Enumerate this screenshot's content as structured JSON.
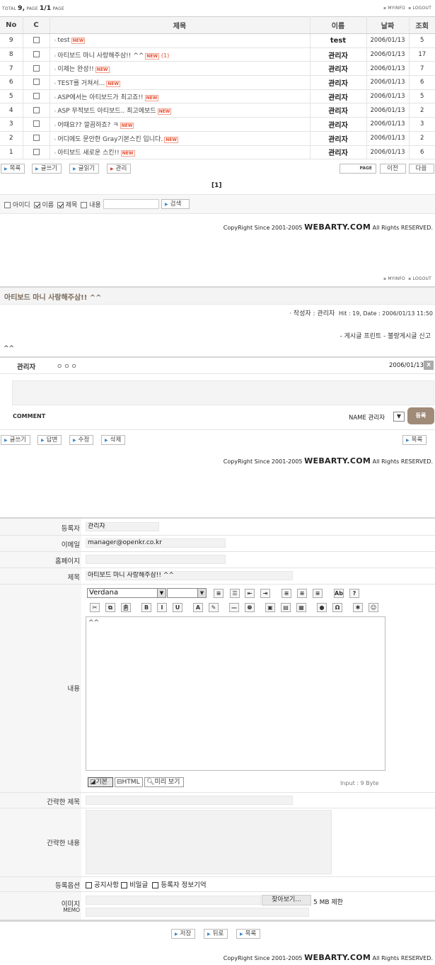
{
  "top": {
    "total_label": "TOTAL",
    "total_value": "9,",
    "page_label": "PAGE",
    "page_value": "1/1",
    "page_suffix": "PAGE",
    "myinfo": "MYINFO",
    "logout": "LOGOUT"
  },
  "table": {
    "headers": [
      "No",
      "C",
      "제목",
      "이름",
      "날짜",
      "조회"
    ],
    "rows": [
      {
        "no": "9",
        "title": "test",
        "comments": "",
        "name": "test",
        "date": "2006/01/13",
        "hits": "5"
      },
      {
        "no": "8",
        "title": "아티보드 마니 사랑해주삼!! ^^",
        "comments": "(1)",
        "name": "관리자",
        "date": "2006/01/13",
        "hits": "17"
      },
      {
        "no": "7",
        "title": "이제는 완성!!",
        "comments": "",
        "name": "관리자",
        "date": "2006/01/13",
        "hits": "7"
      },
      {
        "no": "6",
        "title": "TEST를 거쳐서...",
        "comments": "",
        "name": "관리자",
        "date": "2006/01/13",
        "hits": "6"
      },
      {
        "no": "5",
        "title": "ASP에서는 아티보드가 최고죠!!",
        "comments": "",
        "name": "관리자",
        "date": "2006/01/13",
        "hits": "5"
      },
      {
        "no": "4",
        "title": "ASP 무적보드 아티보드.. 최고에보드",
        "comments": "",
        "name": "관리자",
        "date": "2006/01/13",
        "hits": "2"
      },
      {
        "no": "3",
        "title": "어때요?? 깔끔하죠? ㅋ",
        "comments": "",
        "name": "관리자",
        "date": "2006/01/13",
        "hits": "3"
      },
      {
        "no": "2",
        "title": "어디에도 문안한 Gray기본스킨 입니다.",
        "comments": "",
        "name": "관리자",
        "date": "2006/01/13",
        "hits": "2"
      },
      {
        "no": "1",
        "title": "아티보드 새로운 스킨!!",
        "comments": "",
        "name": "관리자",
        "date": "2006/01/13",
        "hits": "6"
      }
    ],
    "new_badge": "NEW"
  },
  "list_buttons": {
    "list": "목록",
    "write": "글쓰기",
    "read": "글읽기",
    "manage": "관리",
    "page": "PAGE",
    "prev": "이전",
    "next": "다음"
  },
  "pagination": "[1]",
  "search": {
    "id": "아이디",
    "name": "이름",
    "title": "제목",
    "content": "내용",
    "button": "검색"
  },
  "copyright": {
    "prefix": "CopyRight Since 2001-2005",
    "brand": "WEBARTY.COM",
    "suffix": "All Rights RESERVED."
  },
  "view": {
    "myinfo": "MYINFO",
    "logout": "LOGOUT",
    "title": "아티보드 마니 사랑해주삼!! ^^",
    "author_line": "· 작성자 : 관리자",
    "meta": "Hit : 19, Date : 2006/01/13 11:50",
    "actions": "- 게시글 프린트 - 불량게시글 신고",
    "body": "^^",
    "comment": {
      "author": "관리자",
      "dots": "ㅇㅇㅇ",
      "date": "2006/01/13",
      "close": "x",
      "label": "COMMENT",
      "name_label": "NAME 관리자",
      "submit": "등록"
    },
    "buttons": {
      "write": "글쓰기",
      "reply": "답변",
      "edit": "수정",
      "delete": "삭제",
      "list": "목록"
    }
  },
  "form": {
    "labels": {
      "author": "등록자",
      "email": "이메일",
      "homepage": "홈페이지",
      "title": "제목",
      "content": "내용",
      "short_title": "간략한 제목",
      "short_content": "간략한 내용",
      "options": "등록옵션",
      "image": "이미지",
      "memo": "MEMO"
    },
    "values": {
      "author": "관리자",
      "email": "manager@openkr.co.kr",
      "homepage": "",
      "title": "아티보드 마니 사랑해주삼!! ^^",
      "content": "^^"
    },
    "editor": {
      "font": "Verdana",
      "size": "",
      "mode_basic": "기본",
      "mode_html": "HTML",
      "mode_preview": "미리 보기",
      "input_count": "Input : 9 Byte"
    },
    "options": {
      "notice": "공지사항",
      "secret": "비밀글",
      "remember": "등록자 정보기억"
    },
    "file": {
      "browse": "찾아보기...",
      "limit": "5 MB 제한"
    },
    "buttons": {
      "save": "저장",
      "back": "뒤로",
      "list": "목록"
    }
  }
}
